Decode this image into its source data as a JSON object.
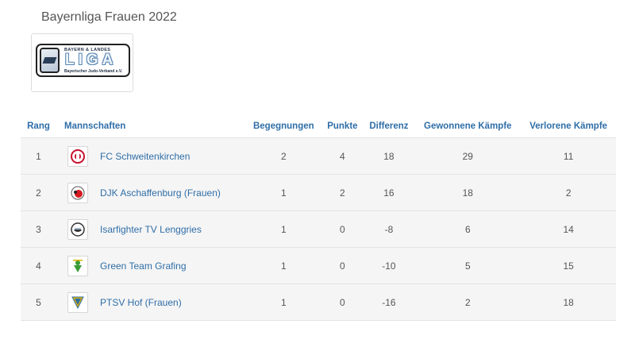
{
  "page": {
    "title": "Bayernliga Frauen 2022"
  },
  "league_logo": {
    "top_text": "BAYERN & LANDES",
    "main_text": "LIGA",
    "sub_text": "Bayerischer Judo-Verband e.V."
  },
  "table": {
    "headers": {
      "rank": "Rang",
      "teams": "Mannschaften",
      "matches": "Begegnungen",
      "points": "Punkte",
      "difference": "Differenz",
      "won": "Gewonnene Kämpfe",
      "lost": "Verlorene Kämpfe"
    },
    "rows": [
      {
        "rank": "1",
        "team": "FC Schweitenkirchen",
        "matches": "2",
        "points": "4",
        "difference": "18",
        "won": "29",
        "lost": "11",
        "logo_icon": "fc-schweitenkirchen-logo",
        "logo_color": "#c8102e"
      },
      {
        "rank": "2",
        "team": "DJK Aschaffenburg (Frauen)",
        "matches": "1",
        "points": "2",
        "difference": "16",
        "won": "18",
        "lost": "2",
        "logo_icon": "djk-aschaffenburg-logo",
        "logo_color": "#d71920"
      },
      {
        "rank": "3",
        "team": "Isarfighter TV Lenggries",
        "matches": "1",
        "points": "0",
        "difference": "-8",
        "won": "6",
        "lost": "14",
        "logo_icon": "isarfighter-logo",
        "logo_color": "#333333"
      },
      {
        "rank": "4",
        "team": "Green Team Grafing",
        "matches": "1",
        "points": "0",
        "difference": "-10",
        "won": "5",
        "lost": "15",
        "logo_icon": "green-team-grafing-logo",
        "logo_color": "#3a9b35"
      },
      {
        "rank": "5",
        "team": "PTSV Hof (Frauen)",
        "matches": "1",
        "points": "0",
        "difference": "-16",
        "won": "2",
        "lost": "18",
        "logo_icon": "ptsv-hof-logo",
        "logo_color": "#e0b100"
      }
    ]
  },
  "colors": {
    "link": "#2f6ea7",
    "text": "#555555",
    "row_bg": "#f5f5f5"
  }
}
